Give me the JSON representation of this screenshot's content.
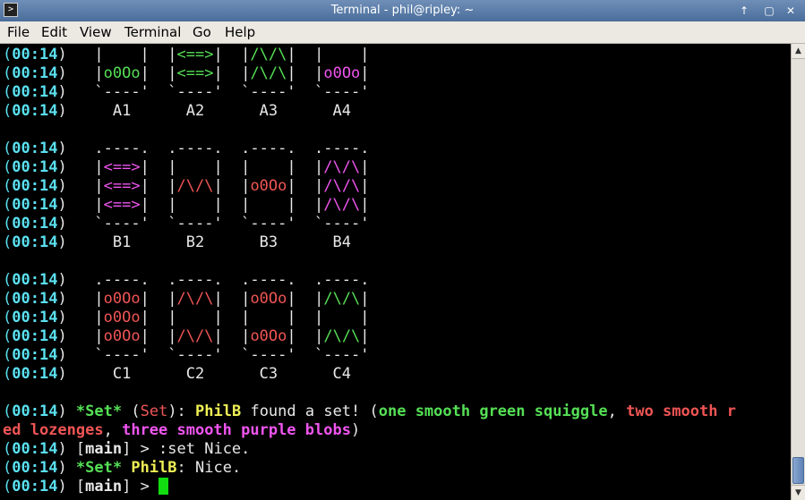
{
  "window": {
    "title": "Terminal - phil@ripley: ~",
    "icon": "terminal-icon",
    "buttons": {
      "up": "↑",
      "max": "▢",
      "close": "✕"
    }
  },
  "menu": [
    "File",
    "Edit",
    "View",
    "Terminal",
    "Go",
    "Help"
  ],
  "colors": {
    "cyan": "#5ae0f0",
    "green": "#55e055",
    "red": "#f05555",
    "magenta": "#f055f0",
    "yellow": "#f0f055",
    "cursor": "#11dd11"
  },
  "lines": [
    [
      [
        "(",
        "par"
      ],
      [
        "00:14",
        "ts"
      ],
      [
        ")   |    |  |",
        "w"
      ],
      [
        "<==>",
        "g"
      ],
      [
        "|  |",
        "w"
      ],
      [
        "/\\/\\",
        "g"
      ],
      [
        "|  |    |",
        "w"
      ]
    ],
    [
      [
        "(",
        "par"
      ],
      [
        "00:14",
        "ts"
      ],
      [
        ")   |",
        "w"
      ],
      [
        "o0Oo",
        "g"
      ],
      [
        "|  |",
        "w"
      ],
      [
        "<==>",
        "g"
      ],
      [
        "|  |",
        "w"
      ],
      [
        "/\\/\\",
        "g"
      ],
      [
        "|  |",
        "w"
      ],
      [
        "o0Oo",
        "m"
      ],
      [
        "|",
        "w"
      ]
    ],
    [
      [
        "(",
        "par"
      ],
      [
        "00:14",
        "ts"
      ],
      [
        ")   `----'  `----'  `----'  `----'",
        "w"
      ]
    ],
    [
      [
        "(",
        "par"
      ],
      [
        "00:14",
        "ts"
      ],
      [
        ")     A1      A2      A3      A4",
        "w"
      ]
    ],
    [],
    [
      [
        "(",
        "par"
      ],
      [
        "00:14",
        "ts"
      ],
      [
        ")   .----.  .----.  .----.  .----.",
        "w"
      ]
    ],
    [
      [
        "(",
        "par"
      ],
      [
        "00:14",
        "ts"
      ],
      [
        ")   |",
        "w"
      ],
      [
        "<==>",
        "m"
      ],
      [
        "|  |    |  |    |  |",
        "w"
      ],
      [
        "/\\/\\",
        "m"
      ],
      [
        "|",
        "w"
      ]
    ],
    [
      [
        "(",
        "par"
      ],
      [
        "00:14",
        "ts"
      ],
      [
        ")   |",
        "w"
      ],
      [
        "<==>",
        "m"
      ],
      [
        "|  |",
        "w"
      ],
      [
        "/\\/\\",
        "r"
      ],
      [
        "|  |",
        "w"
      ],
      [
        "o0Oo",
        "r"
      ],
      [
        "|  |",
        "w"
      ],
      [
        "/\\/\\",
        "m"
      ],
      [
        "|",
        "w"
      ]
    ],
    [
      [
        "(",
        "par"
      ],
      [
        "00:14",
        "ts"
      ],
      [
        ")   |",
        "w"
      ],
      [
        "<==>",
        "m"
      ],
      [
        "|  |    |  |    |  |",
        "w"
      ],
      [
        "/\\/\\",
        "m"
      ],
      [
        "|",
        "w"
      ]
    ],
    [
      [
        "(",
        "par"
      ],
      [
        "00:14",
        "ts"
      ],
      [
        ")   `----'  `----'  `----'  `----'",
        "w"
      ]
    ],
    [
      [
        "(",
        "par"
      ],
      [
        "00:14",
        "ts"
      ],
      [
        ")     B1      B2      B3      B4",
        "w"
      ]
    ],
    [],
    [
      [
        "(",
        "par"
      ],
      [
        "00:14",
        "ts"
      ],
      [
        ")   .----.  .----.  .----.  .----.",
        "w"
      ]
    ],
    [
      [
        "(",
        "par"
      ],
      [
        "00:14",
        "ts"
      ],
      [
        ")   |",
        "w"
      ],
      [
        "o0Oo",
        "r"
      ],
      [
        "|  |",
        "w"
      ],
      [
        "/\\/\\",
        "r"
      ],
      [
        "|  |",
        "w"
      ],
      [
        "o0Oo",
        "r"
      ],
      [
        "|  |",
        "w"
      ],
      [
        "/\\/\\",
        "g"
      ],
      [
        "|",
        "w"
      ]
    ],
    [
      [
        "(",
        "par"
      ],
      [
        "00:14",
        "ts"
      ],
      [
        ")   |",
        "w"
      ],
      [
        "o0Oo",
        "r"
      ],
      [
        "|  |    |  |    |  |    |",
        "w"
      ]
    ],
    [
      [
        "(",
        "par"
      ],
      [
        "00:14",
        "ts"
      ],
      [
        ")   |",
        "w"
      ],
      [
        "o0Oo",
        "r"
      ],
      [
        "|  |",
        "w"
      ],
      [
        "/\\/\\",
        "r"
      ],
      [
        "|  |",
        "w"
      ],
      [
        "o0Oo",
        "r"
      ],
      [
        "|  |",
        "w"
      ],
      [
        "/\\/\\",
        "g"
      ],
      [
        "|",
        "w"
      ]
    ],
    [
      [
        "(",
        "par"
      ],
      [
        "00:14",
        "ts"
      ],
      [
        ")   `----'  `----'  `----'  `----'",
        "w"
      ]
    ],
    [
      [
        "(",
        "par"
      ],
      [
        "00:14",
        "ts"
      ],
      [
        ")     C1      C2      C3      C4",
        "w"
      ]
    ],
    [],
    [
      [
        "(",
        "par"
      ],
      [
        "00:14",
        "ts"
      ],
      [
        ") ",
        "w"
      ],
      [
        "*Set*",
        "g b"
      ],
      [
        " (",
        "w"
      ],
      [
        "Set",
        "r"
      ],
      [
        "): ",
        "w"
      ],
      [
        "PhilB",
        "y"
      ],
      [
        " found a set! (",
        "w"
      ],
      [
        "one smooth green squiggle",
        "g b"
      ],
      [
        ", ",
        "w"
      ],
      [
        "two smooth r",
        "r b"
      ]
    ],
    [
      [
        "ed lozenges",
        "r b"
      ],
      [
        ", ",
        "w"
      ],
      [
        "three smooth purple blobs",
        "m b"
      ],
      [
        ")",
        "w"
      ]
    ],
    [
      [
        "(",
        "par"
      ],
      [
        "00:14",
        "ts"
      ],
      [
        ") [",
        "w"
      ],
      [
        "main",
        "w b"
      ],
      [
        "] > :set Nice.",
        "w"
      ]
    ],
    [
      [
        "(",
        "par"
      ],
      [
        "00:14",
        "ts"
      ],
      [
        ") ",
        "w"
      ],
      [
        "*Set*",
        "g b"
      ],
      [
        " ",
        "w"
      ],
      [
        "PhilB",
        "y"
      ],
      [
        ": Nice.",
        "w"
      ]
    ],
    [
      [
        "(",
        "par"
      ],
      [
        "00:14",
        "ts"
      ],
      [
        ") [",
        "w"
      ],
      [
        "main",
        "w b"
      ],
      [
        "] > ",
        "w"
      ]
    ]
  ]
}
